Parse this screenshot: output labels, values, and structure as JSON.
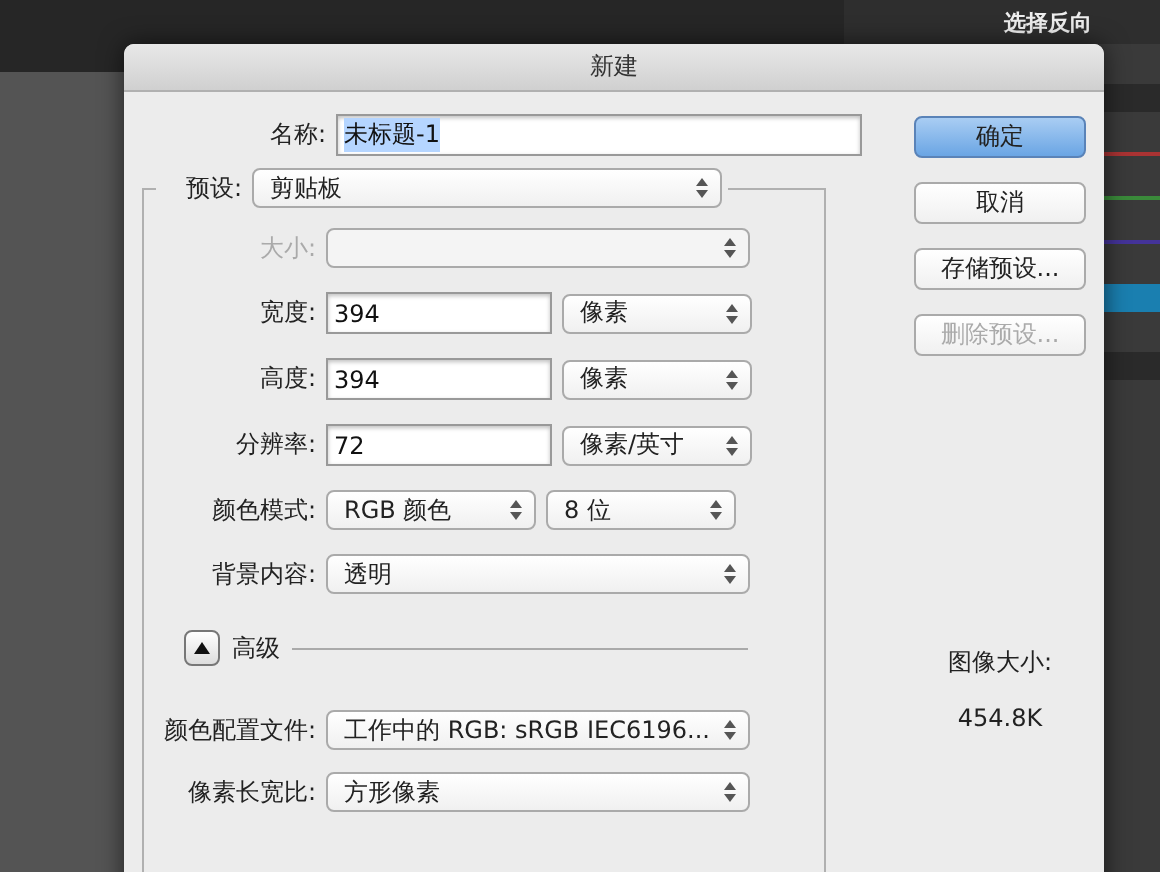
{
  "background": {
    "panel_items": [
      {
        "label": "选择反向"
      }
    ]
  },
  "dialog": {
    "title": "新建",
    "name": {
      "label": "名称:",
      "value": "未标题-1",
      "selected": true
    },
    "preset": {
      "label": "预设:",
      "value": "剪贴板"
    },
    "rows": [
      {
        "kind": "select",
        "label": "大小:",
        "disabled": true
      },
      {
        "kind": "input_unit",
        "label": "宽度:",
        "value": "394",
        "unit": "像素"
      },
      {
        "kind": "input_unit",
        "label": "高度:",
        "value": "394",
        "unit": "像素"
      },
      {
        "kind": "input_unit",
        "label": "分辨率:",
        "value": "72",
        "unit": "像素/英寸"
      },
      {
        "kind": "double_select",
        "label": "颜色模式:",
        "value": "RGB 颜色",
        "unit": "8 位"
      },
      {
        "kind": "select",
        "label": "背景内容:",
        "value": "透明",
        "disabled": false
      }
    ],
    "advanced": {
      "label": "高级",
      "expanded": true,
      "rows": [
        {
          "kind": "select",
          "label": "颜色配置文件:",
          "value": "工作中的 RGB: sRGB IEC6196...",
          "disabled": false
        },
        {
          "kind": "select",
          "label": "像素长宽比:",
          "value": "方形像素",
          "disabled": false
        }
      ]
    },
    "buttons": [
      {
        "label": "确定",
        "default": true,
        "disabled": false
      },
      {
        "label": "取消",
        "default": false,
        "disabled": false
      },
      {
        "label": "存储预设...",
        "default": false,
        "disabled": false
      },
      {
        "label": "删除预设...",
        "default": false,
        "disabled": true
      }
    ],
    "image_size": {
      "label": "图像大小:",
      "value": "454.8K"
    }
  }
}
